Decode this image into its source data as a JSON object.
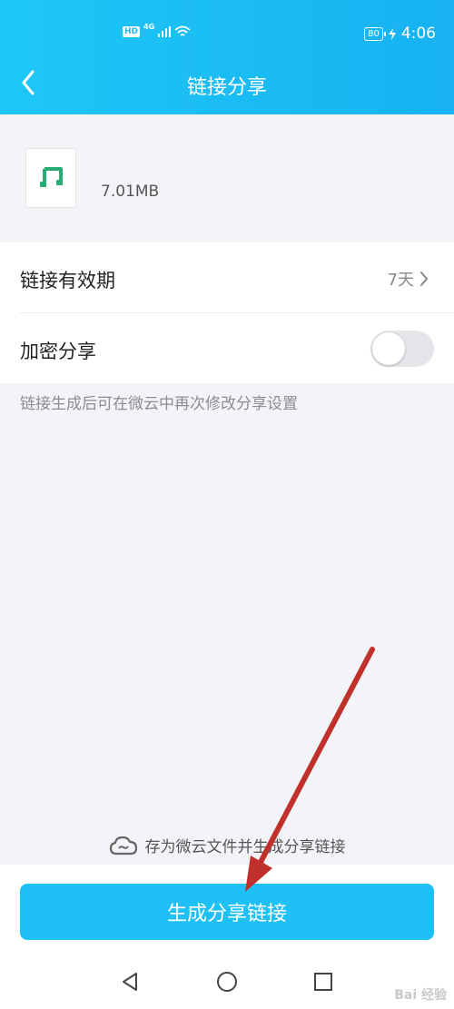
{
  "status_bar": {
    "hd": "HD",
    "network": "4G",
    "battery": "80",
    "time": "4:06"
  },
  "header": {
    "title": "链接分享"
  },
  "file": {
    "size": "7.01MB",
    "icon": "music-note-icon",
    "icon_color": "#27ad74"
  },
  "settings": {
    "validity_label": "链接有效期",
    "validity_value": "7天",
    "encrypt_label": "加密分享",
    "encrypt_enabled": false
  },
  "hint": "链接生成后可在微云中再次修改分享设置",
  "save_note": "存为微云文件并生成分享链接",
  "primary_button": "生成分享链接",
  "watermark": "Bai 经验",
  "colors": {
    "accent": "#1ec0f5",
    "arrow": "#c0312b"
  }
}
